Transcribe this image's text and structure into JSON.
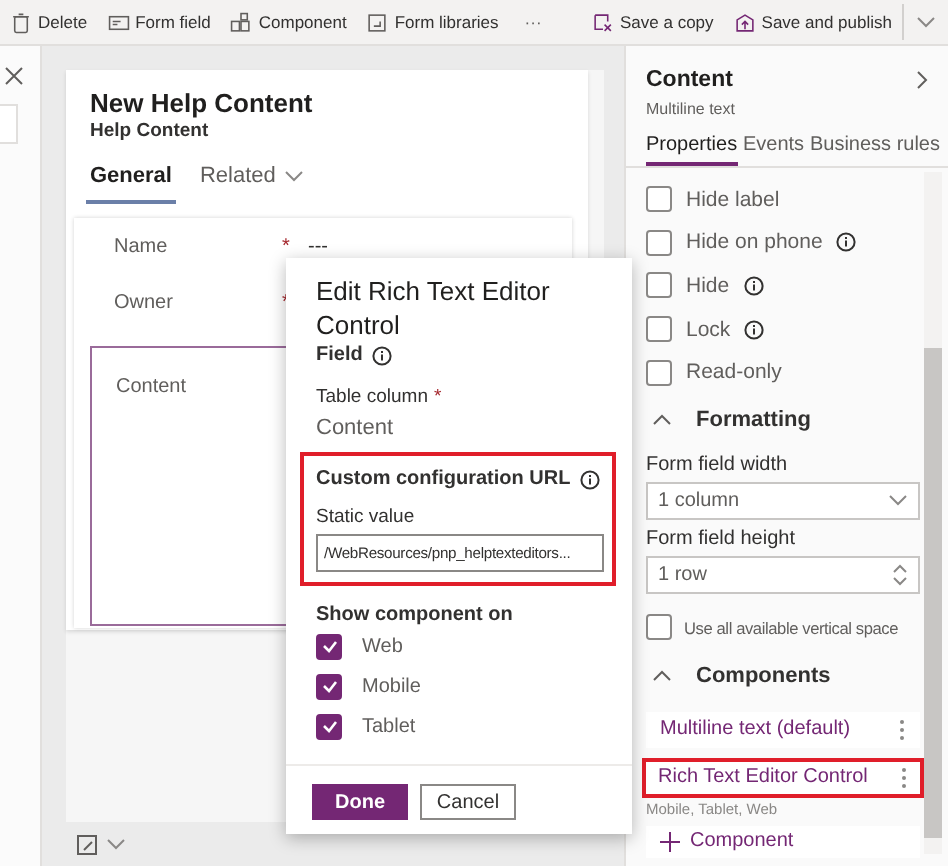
{
  "toolbar": {
    "left": [
      {
        "label": "Delete"
      },
      {
        "label": "Form field"
      },
      {
        "label": "Component"
      },
      {
        "label": "Form libraries"
      }
    ],
    "more": "···",
    "right": [
      {
        "label": "Save a copy"
      },
      {
        "label": "Save and publish"
      }
    ]
  },
  "form": {
    "title": "New Help Content",
    "subtitle": "Help Content",
    "tabs": [
      {
        "label": "General",
        "selected": true,
        "menu": false
      },
      {
        "label": "Related",
        "selected": false,
        "menu": true
      }
    ],
    "fields": [
      {
        "label": "Name",
        "required_mark": "*",
        "value": "---"
      },
      {
        "label": "Owner",
        "required_mark": "*"
      },
      {
        "label": "Content",
        "kind": "multiline"
      }
    ]
  },
  "dialog": {
    "title": "Edit Rich Text Editor Control",
    "field_heading": "Field",
    "column_label": "Table column",
    "column_required_mark": "*",
    "column_value": "Content",
    "url_section": {
      "heading": "Custom configuration URL",
      "highlighted": true,
      "static_label": "Static value",
      "value": "/WebResources/pnp_helptexteditors..."
    },
    "show_heading": "Show component on",
    "show_on": [
      {
        "label": "Web",
        "checked": true
      },
      {
        "label": "Mobile",
        "checked": true
      },
      {
        "label": "Tablet",
        "checked": true
      }
    ],
    "buttons": [
      {
        "label": "Done",
        "kind": "primary"
      },
      {
        "label": "Cancel",
        "kind": "secondary"
      }
    ]
  },
  "panel": {
    "title": "Content",
    "subtitle": "Multiline text",
    "tabs": [
      {
        "label": "Properties",
        "selected": true
      },
      {
        "label": "Events",
        "selected": false
      },
      {
        "label": "Business rules",
        "selected": false
      }
    ],
    "options": [
      {
        "label": "Hide label",
        "checked": false,
        "kind": "plain"
      },
      {
        "label": "Hide on phone",
        "checked": false,
        "kind": "info"
      },
      {
        "label": "Hide",
        "checked": false,
        "kind": "info"
      },
      {
        "label": "Lock",
        "checked": false,
        "kind": "info"
      },
      {
        "label": "Read-only",
        "checked": false,
        "kind": "plain"
      }
    ],
    "formatting": {
      "heading": "Formatting",
      "expanded": true,
      "width_label": "Form field width",
      "width_value": "1 column",
      "height_label": "Form field height",
      "height_value": "1 row",
      "vertical_space": {
        "label": "Use all available vertical space",
        "checked": false
      }
    },
    "components": {
      "heading": "Components",
      "expanded": true,
      "items": [
        {
          "label": "Multiline text (default)",
          "highlighted": false
        },
        {
          "label": "Rich Text Editor Control",
          "highlighted": true
        }
      ],
      "caption": "Mobile, Tablet, Web",
      "add": "Component"
    }
  }
}
